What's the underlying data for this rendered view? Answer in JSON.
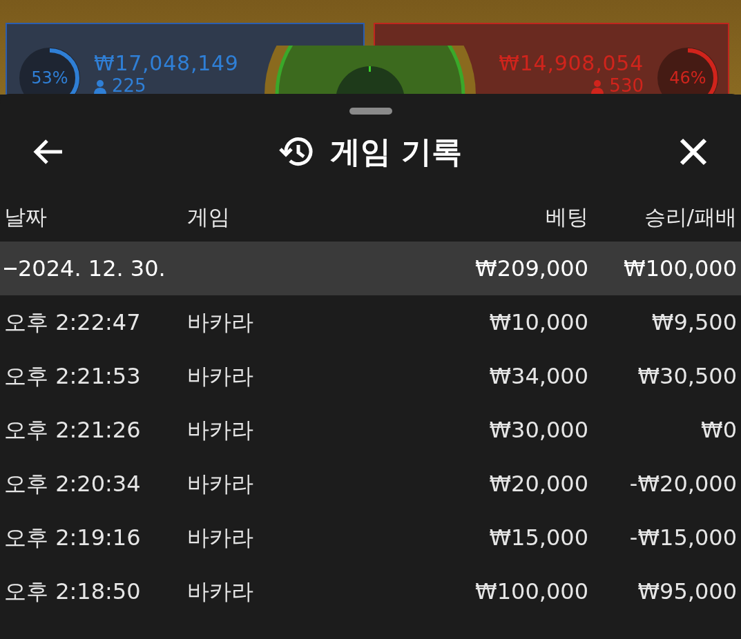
{
  "background_game": {
    "player": {
      "percent": "53%",
      "amount": "₩17,048,149",
      "count": "225"
    },
    "banker": {
      "percent": "46%",
      "amount": "₩14,908,054",
      "count": "530"
    }
  },
  "sheet": {
    "title": "게임 기록",
    "columns": [
      "날짜",
      "게임",
      "베팅",
      "승리/패배"
    ],
    "groups": [
      {
        "date": "2024. 12. 30.",
        "expanded": true,
        "bet": "₩209,000",
        "result": "₩100,000",
        "rows": [
          {
            "time": "오후 2:22:47",
            "game": "바카라",
            "bet": "₩10,000",
            "result": "₩9,500"
          },
          {
            "time": "오후 2:21:53",
            "game": "바카라",
            "bet": "₩34,000",
            "result": "₩30,500"
          },
          {
            "time": "오후 2:21:26",
            "game": "바카라",
            "bet": "₩30,000",
            "result": "₩0"
          },
          {
            "time": "오후 2:20:34",
            "game": "바카라",
            "bet": "₩20,000",
            "result": "-₩20,000"
          },
          {
            "time": "오후 2:19:16",
            "game": "바카라",
            "bet": "₩15,000",
            "result": "-₩15,000"
          },
          {
            "time": "오후 2:18:50",
            "game": "바카라",
            "bet": "₩100,000",
            "result": "₩95,000"
          }
        ]
      }
    ]
  }
}
